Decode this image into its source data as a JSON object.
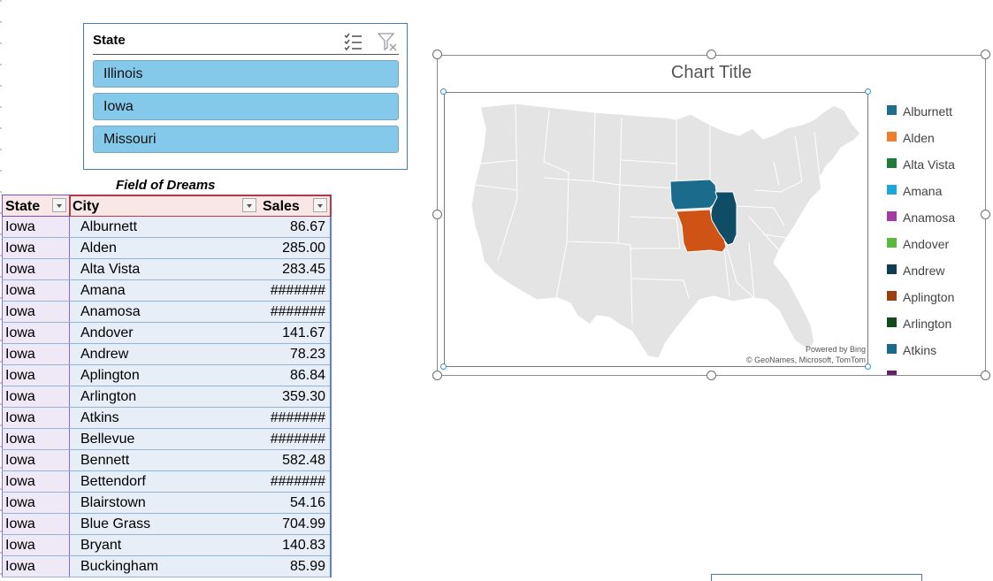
{
  "slicer": {
    "title": "State",
    "items": [
      "Illinois",
      "Iowa",
      "Missouri"
    ],
    "icons": [
      "multi-select-icon",
      "clear-filter-icon"
    ]
  },
  "table": {
    "title": "Field of Dreams",
    "headers": [
      "State",
      "City",
      "Sales"
    ],
    "rows": [
      [
        "Iowa",
        "Alburnett",
        "86.67"
      ],
      [
        "Iowa",
        "Alden",
        "285.00"
      ],
      [
        "Iowa",
        "Alta Vista",
        "283.45"
      ],
      [
        "Iowa",
        "Amana",
        "#######"
      ],
      [
        "Iowa",
        "Anamosa",
        "#######"
      ],
      [
        "Iowa",
        "Andover",
        "141.67"
      ],
      [
        "Iowa",
        "Andrew",
        "78.23"
      ],
      [
        "Iowa",
        "Aplington",
        "86.84"
      ],
      [
        "Iowa",
        "Arlington",
        "359.30"
      ],
      [
        "Iowa",
        "Atkins",
        "#######"
      ],
      [
        "Iowa",
        "Bellevue",
        "#######"
      ],
      [
        "Iowa",
        "Bennett",
        "582.48"
      ],
      [
        "Iowa",
        "Bettendorf",
        "#######"
      ],
      [
        "Iowa",
        "Blairstown",
        "54.16"
      ],
      [
        "Iowa",
        "Blue Grass",
        "704.99"
      ],
      [
        "Iowa",
        "Bryant",
        "140.83"
      ],
      [
        "Iowa",
        "Buckingham",
        "85.99"
      ]
    ]
  },
  "chart": {
    "title": "Chart Title",
    "credit_line1": "Powered by Bing",
    "credit_line2": "© GeoNames, Microsoft, TomTom",
    "legend": [
      {
        "label": "Alburnett",
        "color": "#1f6e8c"
      },
      {
        "label": "Alden",
        "color": "#ed7d31"
      },
      {
        "label": "Alta Vista",
        "color": "#1e7b3a"
      },
      {
        "label": "Amana",
        "color": "#1ea6d8"
      },
      {
        "label": "Anamosa",
        "color": "#a43aa5"
      },
      {
        "label": "Andover",
        "color": "#5cb83e"
      },
      {
        "label": "Andrew",
        "color": "#0e3d52"
      },
      {
        "label": "Aplington",
        "color": "#9b3e12"
      },
      {
        "label": "Arlington",
        "color": "#134a1c"
      },
      {
        "label": "Atkins",
        "color": "#1a6b88"
      },
      {
        "label": "",
        "color": "#6a1f6b"
      }
    ],
    "highlighted_states": [
      {
        "name": "Iowa",
        "color": "#1a6b8c"
      },
      {
        "name": "Illinois",
        "color": "#0f4c65"
      },
      {
        "name": "Missouri",
        "color": "#cf5315"
      }
    ],
    "base_map_color": "#e4e4e4"
  }
}
